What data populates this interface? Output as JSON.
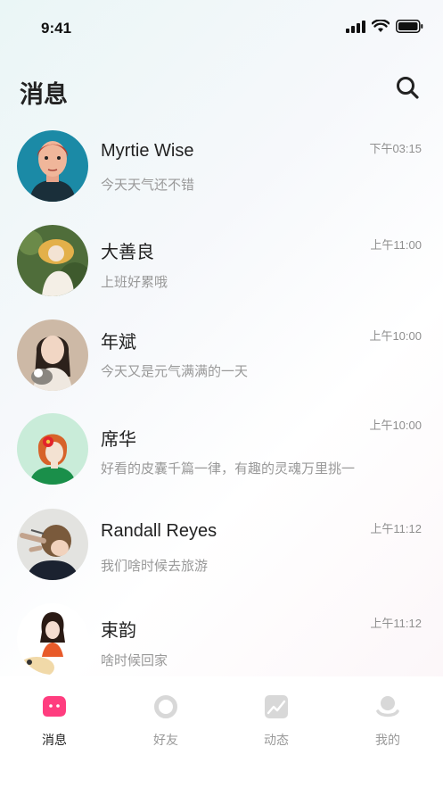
{
  "status_bar": {
    "time": "9:41"
  },
  "header": {
    "title": "消息",
    "search_icon": "search-icon"
  },
  "messages": [
    {
      "name": "Myrtie Wise",
      "preview": "今天天气还不错",
      "time": "下午03:15"
    },
    {
      "name": "大善良",
      "preview": "上班好累哦",
      "time": "上午11:00"
    },
    {
      "name": "年斌",
      "preview": "今天又是元气满满的一天",
      "time": "上午10:00"
    },
    {
      "name": "席华",
      "preview": "好看的皮囊千篇一律，有趣的灵魂万里挑一",
      "time": "上午10:00"
    },
    {
      "name": "Randall Reyes",
      "preview": "我们啥时候去旅游",
      "time": "上午11:12"
    },
    {
      "name": "束韵",
      "preview": "啥时候回家",
      "time": "上午11:12"
    }
  ],
  "tabbar": {
    "tabs": [
      {
        "label": "消息",
        "icon": "message-icon",
        "active": true
      },
      {
        "label": "好友",
        "icon": "friends-icon",
        "active": false
      },
      {
        "label": "动态",
        "icon": "moments-icon",
        "active": false
      },
      {
        "label": "我的",
        "icon": "profile-icon",
        "active": false
      }
    ]
  },
  "colors": {
    "accent": "#ff3d7f",
    "text": "#222222",
    "secondary": "#999999",
    "inactive_icon": "#d8d8d8"
  }
}
